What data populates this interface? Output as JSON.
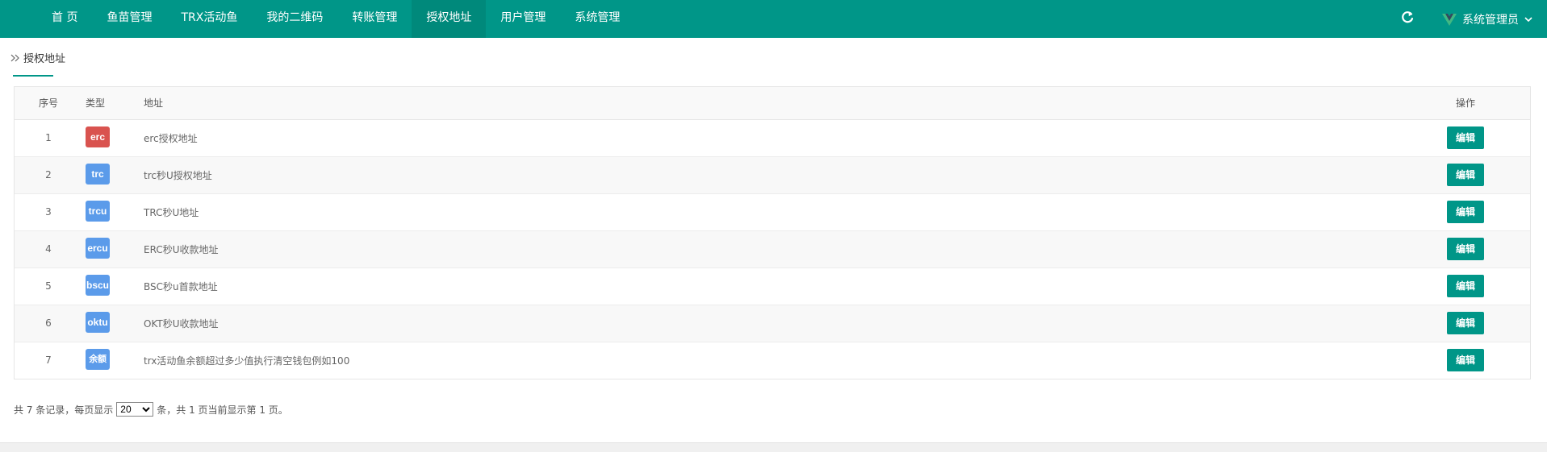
{
  "nav": {
    "items": [
      {
        "label": "首 页",
        "active": false
      },
      {
        "label": "鱼苗管理",
        "active": false
      },
      {
        "label": "TRX活动鱼",
        "active": false
      },
      {
        "label": "我的二维码",
        "active": false
      },
      {
        "label": "转账管理",
        "active": false
      },
      {
        "label": "授权地址",
        "active": true
      },
      {
        "label": "用户管理",
        "active": false
      },
      {
        "label": "系统管理",
        "active": false
      }
    ],
    "user_label": "系统管理员",
    "user_menu_icon": "chevron-down-icon",
    "refresh_icon": "refresh-icon",
    "accent_color": "#009688"
  },
  "breadcrumb": {
    "label": "授权地址"
  },
  "table": {
    "headers": {
      "index": "序号",
      "type": "类型",
      "address": "地址",
      "action": "操作"
    },
    "rows": [
      {
        "index": "1",
        "type": "erc",
        "type_color": "#d9534f",
        "address": "erc授权地址",
        "action": "编辑"
      },
      {
        "index": "2",
        "type": "trc",
        "type_color": "#5b9bea",
        "address": "trc秒U授权地址",
        "action": "编辑"
      },
      {
        "index": "3",
        "type": "trcu",
        "type_color": "#5b9bea",
        "address": "TRC秒U地址",
        "action": "编辑"
      },
      {
        "index": "4",
        "type": "ercu",
        "type_color": "#5b9bea",
        "address": "ERC秒U收款地址",
        "action": "编辑"
      },
      {
        "index": "5",
        "type": "bscu",
        "type_color": "#5b9bea",
        "address": "BSC秒u首款地址",
        "action": "编辑"
      },
      {
        "index": "6",
        "type": "oktu",
        "type_color": "#5b9bea",
        "address": "OKT秒U收款地址",
        "action": "编辑"
      },
      {
        "index": "7",
        "type": "余额",
        "type_color": "#5b9bea",
        "address": "trx活动鱼余额超过多少值执行清空钱包例如100",
        "action": "编辑"
      }
    ]
  },
  "pager": {
    "prefix": "共 7 条记录，每页显示",
    "page_size": "20",
    "page_size_options": [
      "20"
    ],
    "suffix": "条，共 1 页当前显示第 1 页。"
  }
}
